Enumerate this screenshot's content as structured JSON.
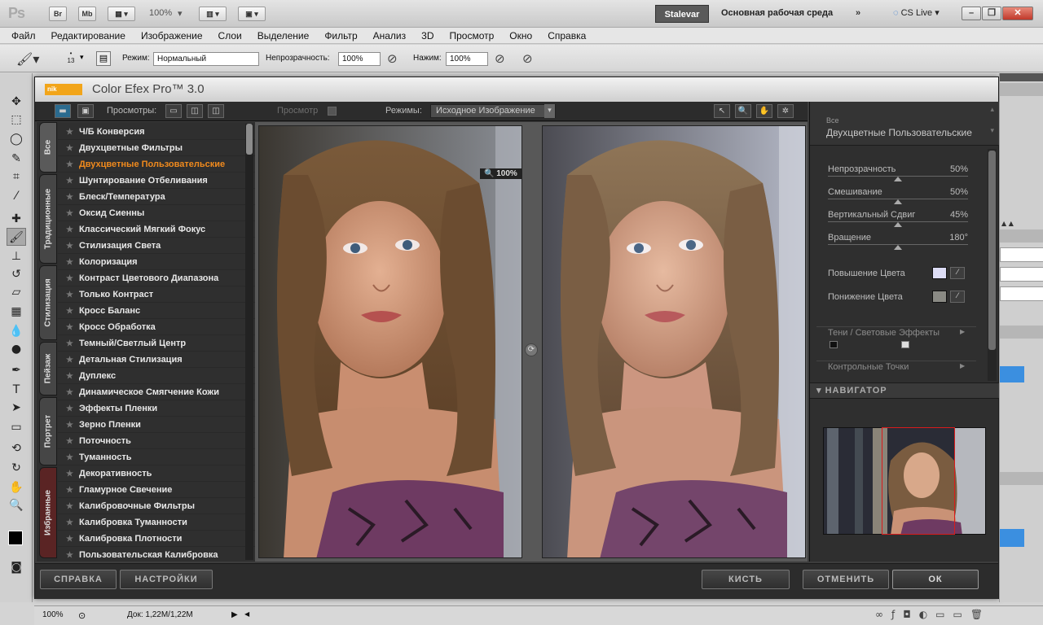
{
  "titlebar": {
    "ps_logo": "Ps",
    "br_btn": "Br",
    "mb_btn": "Mb",
    "zoom": "100%",
    "workspace_user": "Stalevar",
    "workspace_main": "Основная рабочая среда",
    "cs_live": "CS Live"
  },
  "menu": [
    "Файл",
    "Редактирование",
    "Изображение",
    "Слои",
    "Выделение",
    "Фильтр",
    "Анализ",
    "3D",
    "Просмотр",
    "Окно",
    "Справка"
  ],
  "options": {
    "brush_size": "13",
    "mode_label": "Режим:",
    "mode_value": "Нормальный",
    "opacity_label": "Непрозрачность:",
    "opacity_value": "100%",
    "flow_label": "Нажим:",
    "flow_value": "100%"
  },
  "plugin": {
    "logo_text": "nik",
    "title": "Color Efex Pro™ 3.0",
    "views_label": "Просмотры:",
    "preview_label": "Просмотр",
    "modes_label": "Режимы:",
    "mode_value": "Исходное Изображение",
    "zoom": "100%",
    "tabs": [
      "Все",
      "Традиционные",
      "Стилизация",
      "Пейзаж",
      "Портрет",
      "Избранные"
    ],
    "filters": [
      "Ч/Б Конверсия",
      "Двухцветные Фильтры",
      "Двухцветные Пользовательские",
      "Шунтирование Отбеливания",
      "Блеск/Температура",
      "Оксид Сиенны",
      "Классический Мягкий Фокус",
      "Стилизация Света",
      "Колоризация",
      "Контраст Цветового Диапазона",
      "Только Контраст",
      "Кросс Баланс",
      "Кросс Обработка",
      "Темный/Светлый Центр",
      "Детальная Стилизация",
      "Дуплекс",
      "Динамическое Смягчение Кожи",
      "Эффекты Пленки",
      "Зерно Пленки",
      "Поточность",
      "Туманность",
      "Декоративность",
      "Гламурное Свечение",
      "Калибровочные Фильтры",
      "Калибровка Туманности",
      "Калибровка Плотности",
      "Пользовательская Калибровка"
    ],
    "active_filter_index": 2,
    "panel": {
      "category": "Все",
      "filter_name": "Двухцветные Пользовательские",
      "sliders": [
        {
          "label": "Непрозрачность",
          "value": "50%",
          "level": 0.5
        },
        {
          "label": "Смешивание",
          "value": "50%",
          "level": 0.5
        },
        {
          "label": "Вертикальный Сдвиг",
          "value": "45%",
          "level": 0.5
        },
        {
          "label": "Вращение",
          "value": "180°",
          "level": 0.5
        }
      ],
      "color_up_label": "Повышение Цвета",
      "color_up": "#dcdcf4",
      "color_down_label": "Понижение Цвета",
      "color_down": "#8a8a84",
      "shadows_label": "Тени / Световые Эффекты",
      "control_points_label": "Контрольные Точки",
      "navigator_label": "НАВИГАТОР"
    },
    "buttons": {
      "help": "СПРАВКА",
      "settings": "НАСТРОЙКИ",
      "brush": "КИСТЬ",
      "cancel": "ОТМЕНИТЬ",
      "ok": "ОК"
    }
  },
  "status": {
    "zoom": "100%",
    "doc": "Док: 1,22M/1,22M"
  }
}
